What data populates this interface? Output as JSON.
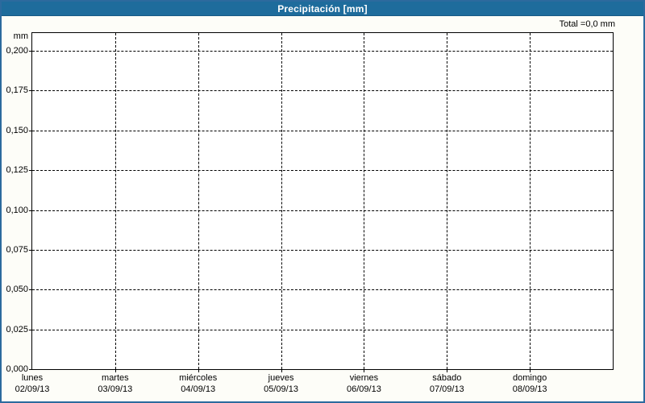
{
  "window": {
    "title": "Precipitación [mm]"
  },
  "summary": {
    "total_text": "Total =0,0 mm"
  },
  "chart_data": {
    "type": "bar",
    "title": "Precipitación [mm]",
    "subtitle": "",
    "unit_label": "mm",
    "ylabel": "mm",
    "xlabel": "",
    "total_label": "Total =0,0 mm",
    "total_value_mm": 0.0,
    "ylim": [
      0,
      0.2112
    ],
    "grid": true,
    "legend_position": "none",
    "yticks": [
      {
        "value": 0.0,
        "label": "0,000"
      },
      {
        "value": 0.025,
        "label": "0,025"
      },
      {
        "value": 0.05,
        "label": "0,050"
      },
      {
        "value": 0.075,
        "label": "0,075"
      },
      {
        "value": 0.1,
        "label": "0,100"
      },
      {
        "value": 0.125,
        "label": "0,125"
      },
      {
        "value": 0.15,
        "label": "0,150"
      },
      {
        "value": 0.175,
        "label": "0,175"
      },
      {
        "value": 0.2,
        "label": "0,200"
      }
    ],
    "categories": [
      {
        "day": "lunes",
        "date": "02/09/13"
      },
      {
        "day": "martes",
        "date": "03/09/13"
      },
      {
        "day": "miércoles",
        "date": "04/09/13"
      },
      {
        "day": "jueves",
        "date": "05/09/13"
      },
      {
        "day": "viernes",
        "date": "06/09/13"
      },
      {
        "day": "sábado",
        "date": "07/09/13"
      },
      {
        "day": "domingo",
        "date": "08/09/13"
      }
    ],
    "series": [
      {
        "name": "Precipitación",
        "values": [
          0,
          0,
          0,
          0,
          0,
          0,
          0
        ]
      }
    ]
  },
  "colors": {
    "header_bg": "#1e6c9c",
    "header_text": "#ffffff",
    "frame_border": "#2c6a9e",
    "plot_border": "#000000",
    "grid": "#000000",
    "background": "#fdfdf8",
    "plot_bg": "#ffffff",
    "text": "#000000"
  }
}
